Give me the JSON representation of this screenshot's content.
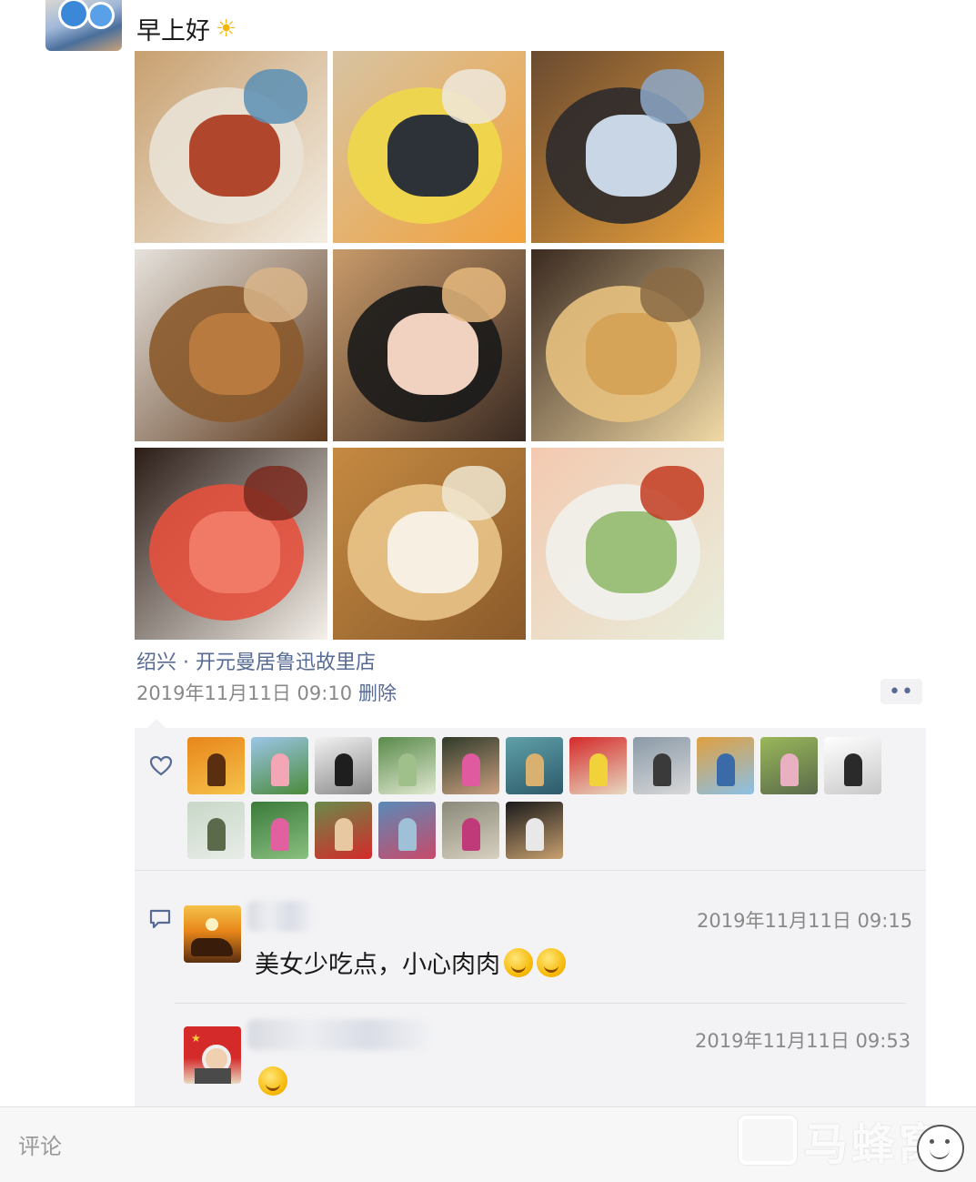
{
  "post": {
    "text": "早上好",
    "sun_icon": "sun-emoji",
    "location": "绍兴 · 开元曼居鲁迅故里店",
    "timestamp": "2019年11月11日 09:10",
    "delete_label": "删除",
    "more_label": "••",
    "photos": [
      {
        "name": "photo-braised-pork-plate",
        "colors": [
          "#c8a070",
          "#e9e2d6",
          "#b0472c",
          "#f3ede3",
          "#5a8fb5"
        ]
      },
      {
        "name": "photo-corn-soup",
        "colors": [
          "#d7c3a2",
          "#f0d84a",
          "#2d3138",
          "#f2a23c",
          "#efe8dc"
        ]
      },
      {
        "name": "photo-restaurant-interior",
        "colors": [
          "#6a4a30",
          "#2d2a2b",
          "#c9d6e6",
          "#e8a03a",
          "#8da8c8"
        ]
      },
      {
        "name": "photo-fried-chicken",
        "colors": [
          "#e6e2dc",
          "#8b5a2c",
          "#b87a3e",
          "#5e3a1e",
          "#d9b58a"
        ]
      },
      {
        "name": "photo-selfie-hat",
        "colors": [
          "#c89a6a",
          "#1a1a1a",
          "#f1d1c0",
          "#3a2a22",
          "#e6b87e"
        ]
      },
      {
        "name": "photo-fried-dough-sticks",
        "colors": [
          "#3a2a20",
          "#e7c280",
          "#d6a458",
          "#f1d9a6",
          "#8a6a44"
        ]
      },
      {
        "name": "photo-watermelon",
        "colors": [
          "#2b1c16",
          "#e6503d",
          "#f07a66",
          "#f5f1ea",
          "#7a2a20"
        ]
      },
      {
        "name": "photo-toast-breakfast",
        "colors": [
          "#c58a42",
          "#e9c48a",
          "#f7efe2",
          "#8a5a2a",
          "#f0e6d0"
        ]
      },
      {
        "name": "photo-lettuce-salad",
        "colors": [
          "#f3c9b0",
          "#f1f1ec",
          "#9cbf7a",
          "#e8eedc",
          "#c23b20"
        ]
      }
    ]
  },
  "likes": {
    "heart_icon": "heart-outline-icon",
    "avatars": [
      {
        "name": "liker-sunset-elephant",
        "colors": [
          "#e8861a",
          "#5a2e10",
          "#f5c24a"
        ]
      },
      {
        "name": "liker-lotus-flag",
        "colors": [
          "#9cc6e8",
          "#f2a6b6",
          "#4a8a3a"
        ]
      },
      {
        "name": "liker-photographer-bw",
        "colors": [
          "#f2f2f2",
          "#1e1e1e",
          "#8a8a8a"
        ]
      },
      {
        "name": "liker-green-lake",
        "colors": [
          "#5a8a4a",
          "#9fc08a",
          "#dfe8d0"
        ]
      },
      {
        "name": "liker-pink-dress",
        "colors": [
          "#2f3a2a",
          "#e05aa0",
          "#caa080"
        ]
      },
      {
        "name": "liker-painted-river",
        "colors": [
          "#5fa0a8",
          "#d8b070",
          "#2d5a6a"
        ]
      },
      {
        "name": "liker-flag-girl",
        "colors": [
          "#d42a2a",
          "#f2d23a",
          "#e8d8c0"
        ]
      },
      {
        "name": "liker-couple-rocks",
        "colors": [
          "#8a9aa8",
          "#3a3a3a",
          "#d8d8d8"
        ]
      },
      {
        "name": "liker-autumn-lake",
        "colors": [
          "#e0a040",
          "#3a6aa8",
          "#8ac0e8"
        ]
      },
      {
        "name": "liker-flower-field",
        "colors": [
          "#9ab85a",
          "#e8b0c0",
          "#5a6a4a"
        ]
      },
      {
        "name": "liker-camera-man",
        "colors": [
          "#ffffff",
          "#2a2a2a",
          "#c8c8c8"
        ]
      },
      {
        "name": "liker-tree-branch",
        "colors": [
          "#c8d8c8",
          "#5a6a4a",
          "#e8ece8"
        ]
      },
      {
        "name": "liker-pink-flowers",
        "colors": [
          "#3a7a3a",
          "#e060a0",
          "#8ac080"
        ]
      },
      {
        "name": "liker-woman-flag",
        "colors": [
          "#6a8a4a",
          "#e8c8a0",
          "#d42a2a"
        ]
      },
      {
        "name": "liker-woman-coast",
        "colors": [
          "#5a8ab8",
          "#a0c0d8",
          "#c84a6a"
        ]
      },
      {
        "name": "liker-woman-street",
        "colors": [
          "#8a8a7a",
          "#c03a7a",
          "#d8d0c0"
        ]
      },
      {
        "name": "liker-hat-portrait",
        "colors": [
          "#1a1a1a",
          "#e8e8e8",
          "#c8a070"
        ]
      }
    ]
  },
  "comments": {
    "comment_icon": "comment-bubble-icon",
    "items": [
      {
        "avatar": "commenter-sunset-elephant",
        "time": "2019年11月11日 09:15",
        "text": "美女少吃点，小心肉肉",
        "emojis": [
          "thinking-emoji",
          "thinking-emoji"
        ]
      },
      {
        "avatar": "commenter-flag-girl",
        "time": "2019年11月11日 09:53",
        "text": "",
        "emojis": [
          "heart-eyes-emoji"
        ]
      }
    ]
  },
  "input": {
    "placeholder": "评论"
  },
  "watermark": {
    "text": "马蜂窝"
  }
}
